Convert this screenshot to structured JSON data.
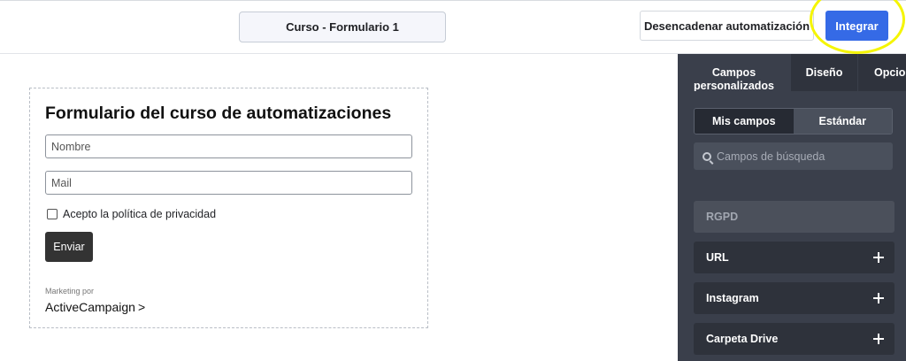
{
  "topbar": {
    "form_title": "Curso - Formulario 1",
    "trigger_label": "Desencadenar automatización",
    "integrate_label": "Integrar"
  },
  "form": {
    "heading": "Formulario del curso de automatizaciones",
    "name_placeholder": "Nombre",
    "mail_placeholder": "Mail",
    "privacy_label": "Acepto la política de privacidad",
    "submit_label": "Enviar",
    "marketing_by": "Marketing por",
    "brand": "ActiveCampaign",
    "brand_mark": ">"
  },
  "panel": {
    "tabs": [
      {
        "label": "Campos personalizados"
      },
      {
        "label": "Diseño"
      },
      {
        "label": "Opcio"
      }
    ],
    "segments": {
      "mine": "Mis campos",
      "standard": "Estándar"
    },
    "search_placeholder": "Campos de búsqueda",
    "fields": [
      {
        "label": "RGPD",
        "state": "disabled"
      },
      {
        "label": "URL",
        "state": "enabled"
      },
      {
        "label": "Instagram",
        "state": "enabled"
      },
      {
        "label": "Carpeta Drive",
        "state": "enabled"
      }
    ]
  },
  "colors": {
    "accent": "#356ae6",
    "highlight": "#f5f500",
    "panel_bg": "#3a3f4b"
  }
}
